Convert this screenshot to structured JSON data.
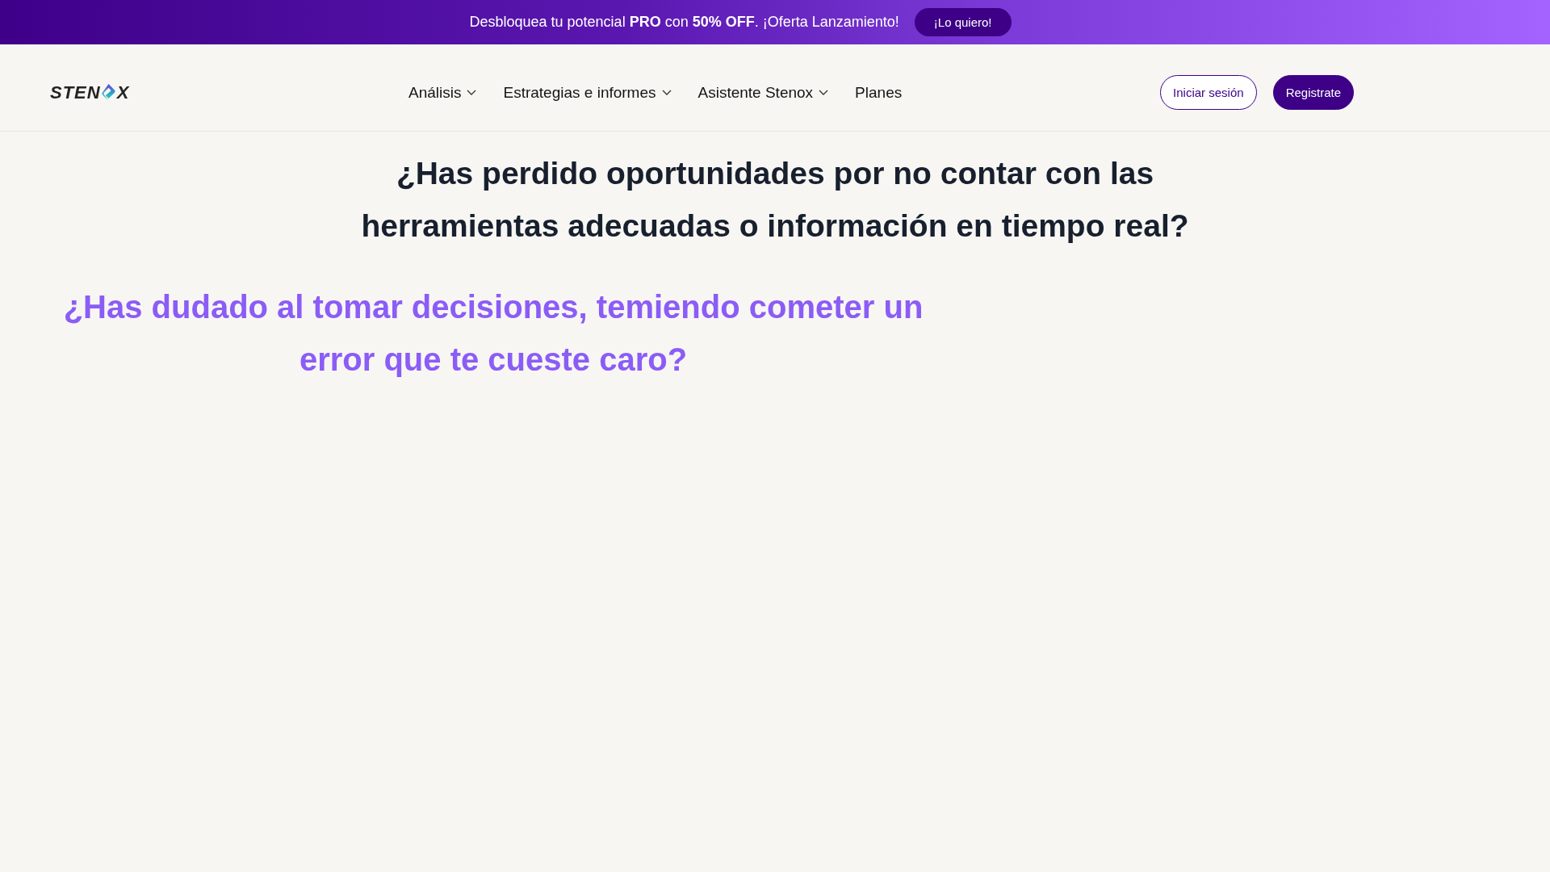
{
  "promo_banner": {
    "text": "Desbloquea tu potencial **PRO** con **50% OFF**. ¡Oferta Lanzamiento!",
    "button": "¡Lo quiero!"
  },
  "header": {
    "logo": {
      "text_before_mark": "STEN",
      "text_after_mark": "X"
    },
    "nav": [
      {
        "label": "Análisis",
        "dropdown": true
      },
      {
        "label": "Estrategias e informes",
        "dropdown": true
      },
      {
        "label": "Asistente Stenox",
        "dropdown": true
      },
      {
        "label": "Planes",
        "dropdown": false
      }
    ],
    "buttons": [
      {
        "label": "Iniciar sesión",
        "kind": "outline"
      },
      {
        "label": "Registrate",
        "kind": "filled"
      }
    ]
  },
  "main": {
    "headline": "¿Has perdido oportunidades por no contar con las herramientas adecuadas o información en tiempo real?",
    "subheadline": "¿Has dudado al tomar decisiones, temiendo cometer un error que te cueste caro?"
  }
}
